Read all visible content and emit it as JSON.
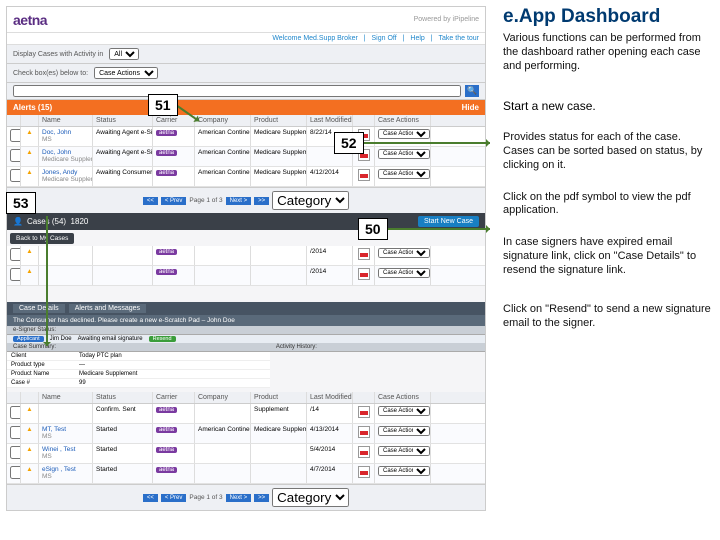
{
  "right": {
    "title": "e.App Dashboard",
    "p1": "Various functions can be performed from the dashboard rather opening each case and performing.",
    "start": "Start a new case.",
    "p2": "Provides status for each of the case. Cases can be sorted based on status, by clicking on it.",
    "p3": "Click on  the pdf symbol to view the pdf application.",
    "p4": "In case signers have expired email signature link, click on \"Case Details\" to resend the signature link.",
    "p5": "Click on \"Resend\" to send a new signature email to the signer."
  },
  "callouts": {
    "n50": "50",
    "n51": "51",
    "n52": "52",
    "n53": "53"
  },
  "top": {
    "logo": "aetna",
    "powered": "Powered by   iPipeline",
    "welcome": "Welcome Med.Supp Broker",
    "signoff": "Sign Off",
    "help": "Help",
    "tour": "Take the tour"
  },
  "filters": {
    "label1": "Display Cases with Activity in",
    "sel1": "All",
    "label2": "Check box(es) below to:",
    "sel2": "Case Actions"
  },
  "search": {
    "placeholder": ""
  },
  "alerts": {
    "header": "Alerts (15)",
    "hide": "Hide",
    "cols": [
      "",
      "",
      "Name",
      "Status",
      "Carrier",
      "Company",
      "Product",
      "Last Modified",
      "",
      "Case Actions"
    ],
    "rows": [
      {
        "name": "Doc, John",
        "sub": "MS",
        "status": "Awaiting Agent e-Signature",
        "company": "American Continental Insurance",
        "product": "Medicare Supplement",
        "date": "8/22/14"
      },
      {
        "name": "Doc, John",
        "sub": "Medicare Supplement",
        "status": "Awaiting Agent e-Signature",
        "company": "American Continental Insurance",
        "product": "Medicare Supplement",
        "date": ""
      },
      {
        "name": "Jones, Andy",
        "sub": "Medicare Supplement",
        "status": "Awaiting Consumer e-Signature",
        "company": "American Continental Insurance",
        "product": "Medicare Supplement",
        "date": "4/12/2014"
      }
    ]
  },
  "pager": {
    "first": "<<",
    "prev": "< Prev",
    "label": "Page 1 of 3",
    "next": "Next >",
    "last": ">>",
    "cat": "Category"
  },
  "cases": {
    "header": "Cases (54)",
    "count": "1820",
    "startBtn": "Start New Case",
    "backTab": "Back to My Cases",
    "rows": [
      {
        "name": "",
        "status": "",
        "date": "/2014"
      },
      {
        "name": "",
        "status": "",
        "date": "/2014"
      }
    ]
  },
  "caseDetails": {
    "tab1": "Case Details",
    "tab2": "Alerts and Messages",
    "alertText": "The Consumer has declined. Please create a new e-Scratch Pad – John Doe",
    "esign": "e-Signer Status:",
    "signer": {
      "role": "Applicant",
      "name": "Jim Doe",
      "status": "Awaiting email signature",
      "btn": "Resend"
    },
    "summaryTitle": "Case Summary:",
    "activityTitle": "Activity History:",
    "cs": [
      {
        "k": "Client",
        "v": "Today PTC plan"
      },
      {
        "k": "Product type",
        "v": "—"
      },
      {
        "k": "Product Name",
        "v": "Medicare Supplement"
      },
      {
        "k": "Case #",
        "v": "99"
      }
    ],
    "bottomCols": [
      "",
      "",
      "Name",
      "Status",
      "Carrier",
      "Company",
      "Product",
      "Last Modified",
      "",
      "Case Actions"
    ],
    "bottomRows": [
      {
        "name": "",
        "status": "Confirm. Sent",
        "product": "Supplement",
        "date": "/14"
      },
      {
        "name": "MT, Test",
        "sub": "MS",
        "status": "Started",
        "company": "American Continental Insurance",
        "product": "Medicare Supplement",
        "date": "4/13/2014"
      },
      {
        "name": "Winei , Test",
        "sub": "MS",
        "status": "Started",
        "company": "",
        "product": "",
        "date": "5/4/2014"
      },
      {
        "name": "eSign , Test",
        "sub": "MS",
        "status": "Started",
        "company": "",
        "product": "",
        "date": "4/7/2014"
      }
    ]
  }
}
